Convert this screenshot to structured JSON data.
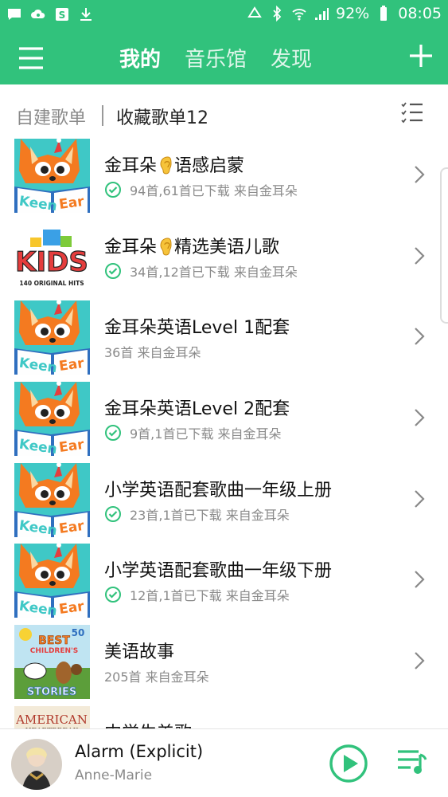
{
  "status_bar": {
    "battery": "92%",
    "time": "08:05"
  },
  "nav": {
    "tabs": [
      "我的",
      "音乐馆",
      "发现"
    ],
    "active_tab": "我的"
  },
  "section": {
    "own": "自建歌单",
    "fav": "收藏歌单12"
  },
  "playlists": [
    {
      "title_a": "金耳朵",
      "title_b": "语感启蒙",
      "ear": true,
      "downloaded": true,
      "sub": "94首,61首已下载 来自金耳朵",
      "cover": "fox"
    },
    {
      "title_a": "金耳朵",
      "title_b": "精选美语儿歌",
      "ear": true,
      "downloaded": true,
      "sub": "34首,12首已下载 来自金耳朵",
      "cover": "kids"
    },
    {
      "title_a": "金耳朵英语Level 1配套",
      "title_b": "",
      "ear": false,
      "downloaded": false,
      "sub": "36首 来自金耳朵",
      "cover": "fox"
    },
    {
      "title_a": "金耳朵英语Level 2配套",
      "title_b": "",
      "ear": false,
      "downloaded": true,
      "sub": "9首,1首已下载 来自金耳朵",
      "cover": "fox"
    },
    {
      "title_a": "小学英语配套歌曲一年级上册",
      "title_b": "",
      "ear": false,
      "downloaded": true,
      "sub": "23首,1首已下载 来自金耳朵",
      "cover": "fox"
    },
    {
      "title_a": "小学英语配套歌曲一年级下册",
      "title_b": "",
      "ear": false,
      "downloaded": true,
      "sub": "12首,1首已下载 来自金耳朵",
      "cover": "fox"
    },
    {
      "title_a": "美语故事",
      "title_b": "",
      "ear": false,
      "downloaded": false,
      "sub": "205首 来自金耳朵",
      "cover": "stories"
    },
    {
      "title_a": "中学生美歌",
      "title_b": "",
      "ear": false,
      "downloaded": false,
      "sub": "",
      "cover": "american"
    }
  ],
  "cover_text": {
    "keen": "Keen",
    "ear": "Ear",
    "kids": "KIDS",
    "kids_sub": "140 ORIGINAL HITS",
    "stories_num": "50",
    "stories_best": "BEST",
    "stories_children": "CHILDREN'S",
    "stories_word": "STORIES",
    "american": "AMERICAN",
    "heartbreak": "HEARTBREAK"
  },
  "player": {
    "song": "Alarm (Explicit)",
    "artist": "Anne-Marie"
  },
  "colors": {
    "brand": "#31c27c",
    "fox_orange": "#f47a20",
    "cover_teal": "#3fc8c6"
  }
}
